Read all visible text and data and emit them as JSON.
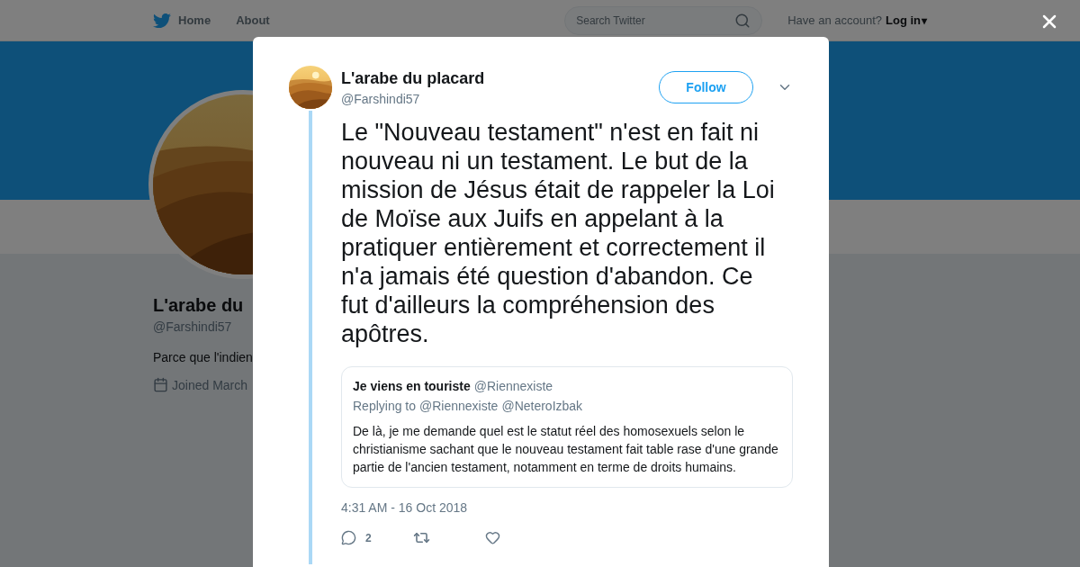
{
  "nav": {
    "items": [
      {
        "label": "Home",
        "kind": "home"
      },
      {
        "label": "About",
        "kind": "plain"
      }
    ],
    "search": {
      "placeholder": "Search Twitter"
    },
    "account_prompt": "Have an account?",
    "login": "Log in",
    "login_caret": "▾"
  },
  "profile": {
    "name": "L'arabe du",
    "handle": "@Farshindi57",
    "bio": "Parce que l'indien",
    "joined": "Joined March"
  },
  "tweet": {
    "name": "L'arabe du placard",
    "handle": "@Farshindi57",
    "follow": "Follow",
    "text": "Le \"Nouveau testament\" n'est en fait ni nouveau ni un testament. Le but de la mission de Jésus était de rappeler la Loi de Moïse aux Juifs en appelant à la pratiquer entièrement et correctement il n'a jamais été question d'abandon. Ce fut d'ailleurs la compréhension des apôtres.",
    "quoted": {
      "name": "Je viens en touriste",
      "handle": "@Riennexiste",
      "replying_label": "Replying to",
      "mentions": [
        "@Riennexiste",
        "@NeteroIzbak"
      ],
      "text": "De là, je me demande quel est le statut réel des homosexuels selon le christianisme sachant que le nouveau testament fait table rase d'une grande partie de l'ancien testament, notamment en terme de droits humains."
    },
    "timestamp": "4:31 AM - 16 Oct 2018",
    "actions": [
      {
        "kind": "reply",
        "count": "2"
      },
      {
        "kind": "retweet"
      },
      {
        "kind": "like"
      }
    ]
  }
}
